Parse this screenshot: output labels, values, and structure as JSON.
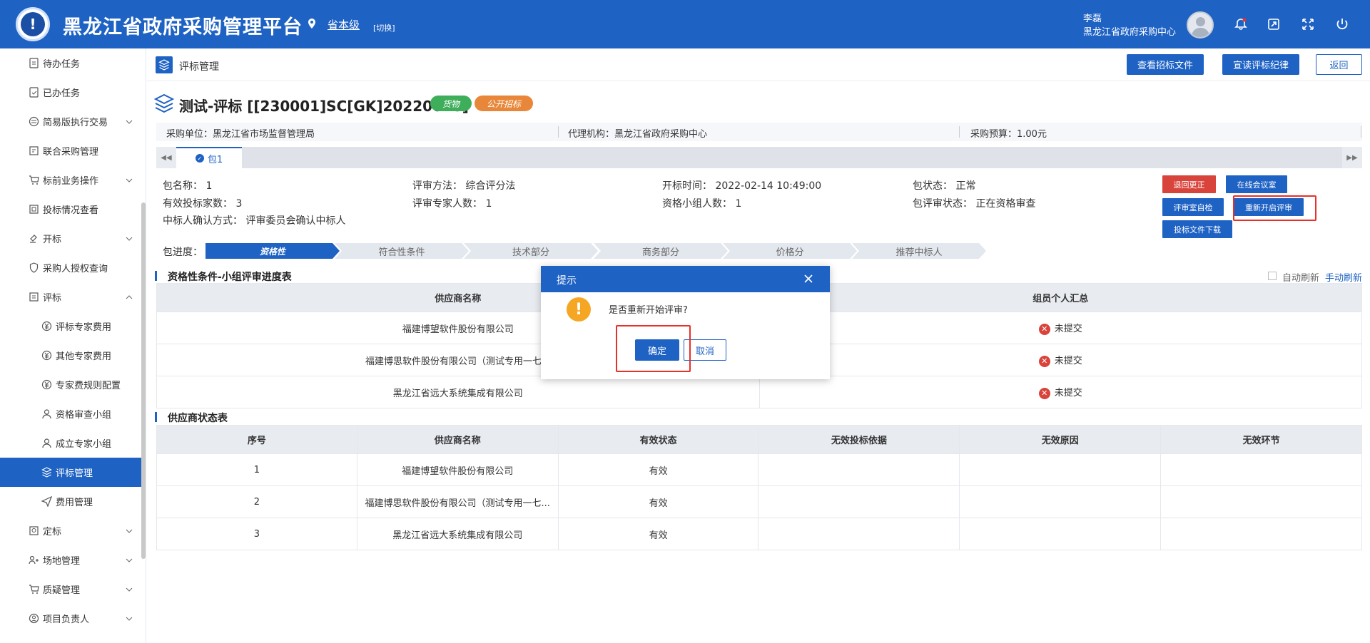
{
  "header": {
    "title": "黑龙江省政府采购管理平台",
    "location": "省本级",
    "switch_label": "[切换]",
    "user_name": "李磊",
    "user_org": "黑龙江省政府采购中心"
  },
  "sidebar": {
    "items": [
      {
        "label": "待办任务",
        "icon": "task-icon"
      },
      {
        "label": "已办任务",
        "icon": "done-task-icon"
      },
      {
        "label": "简易版执行交易",
        "icon": "exchange-icon"
      },
      {
        "label": "联合采购管理",
        "icon": "joint-purchase-icon"
      },
      {
        "label": "标前业务操作",
        "icon": "cart-icon"
      },
      {
        "label": "投标情况查看",
        "icon": "view-icon"
      },
      {
        "label": "开标",
        "icon": "gavel-icon"
      },
      {
        "label": "采购人授权查询",
        "icon": "shield-icon"
      },
      {
        "label": "评标",
        "icon": "evaluate-icon"
      },
      {
        "label": "评标专家费用",
        "icon": "yen-icon"
      },
      {
        "label": "其他专家费用",
        "icon": "yen-icon"
      },
      {
        "label": "专家费规则配置",
        "icon": "yen-icon"
      },
      {
        "label": "资格审查小组",
        "icon": "user-icon"
      },
      {
        "label": "成立专家小组",
        "icon": "user-icon"
      },
      {
        "label": "评标管理",
        "icon": "layers-icon"
      },
      {
        "label": "费用管理",
        "icon": "send-icon"
      },
      {
        "label": "定标",
        "icon": "award-icon"
      },
      {
        "label": "场地管理",
        "icon": "venue-icon"
      },
      {
        "label": "质疑管理",
        "icon": "question-icon"
      },
      {
        "label": "项目负责人",
        "icon": "person-icon"
      }
    ]
  },
  "page": {
    "crumb": "评标管理",
    "btn_view_bid": "查看招标文件",
    "btn_read_rules": "宣读评标纪律",
    "btn_back": "返回",
    "project_title": "测试-评标 [[230001]SC[GK]20220018]",
    "badge_goods": "货物",
    "badge_open": "公开招标",
    "purchaser": "采购单位：黑龙江省市场监督管理局",
    "agency": "代理机构：黑龙江省政府采购中心",
    "budget": "采购预算：1.00元",
    "tab_label": "包1"
  },
  "package": {
    "name": "包名称：  1",
    "method": "评审方法：  综合评分法",
    "open_time": "开标时间：  2022-02-14 10:49:00",
    "status": "包状态：  正常",
    "valid_bidders": "有效投标家数：  3",
    "expert_count": "评审专家人数：  1",
    "group_count": "资格小组人数：  1",
    "review_status": "包评审状态：  正在资格审查",
    "winner_confirm": "中标人确认方式：  评审委员会确认中标人",
    "btn_return": "退回更正",
    "btn_online_room": "在线会议室",
    "btn_self_check": "评审室自检",
    "btn_restart": "重新开启评审",
    "btn_download": "投标文件下载",
    "progress_label": "包进度：",
    "steps": [
      "资格性",
      "符合性条件",
      "技术部分",
      "商务部分",
      "价格分",
      "推荐中标人"
    ]
  },
  "qual_table": {
    "title": "资格性条件-小组评审进度表",
    "auto_refresh": "自动刷新",
    "manual_refresh": "手动刷新",
    "headers": [
      "供应商名称",
      "组员个人汇总"
    ],
    "rows": [
      {
        "supplier": "福建博望软件股份有限公司",
        "status": "未提交"
      },
      {
        "supplier": "福建博思软件股份有限公司（测试专用一七...",
        "status": "未提交"
      },
      {
        "supplier": "黑龙江省远大系统集成有限公司",
        "status": "未提交"
      }
    ]
  },
  "supplier_table": {
    "title": "供应商状态表",
    "headers": [
      "序号",
      "供应商名称",
      "有效状态",
      "无效投标依据",
      "无效原因",
      "无效环节"
    ],
    "rows": [
      {
        "no": "1",
        "name": "福建博望软件股份有限公司",
        "valid": "有效"
      },
      {
        "no": "2",
        "name": "福建博思软件股份有限公司（测试专用一七...",
        "valid": "有效"
      },
      {
        "no": "3",
        "name": "黑龙江省远大系统集成有限公司",
        "valid": "有效"
      }
    ]
  },
  "modal": {
    "title": "提示",
    "message": "是否重新开始评审?",
    "ok": "确定",
    "cancel": "取消"
  },
  "colors": {
    "primary": "#1e62c4",
    "danger": "#d8443b",
    "warning": "#f5a623",
    "highlight": "#e8302a"
  }
}
